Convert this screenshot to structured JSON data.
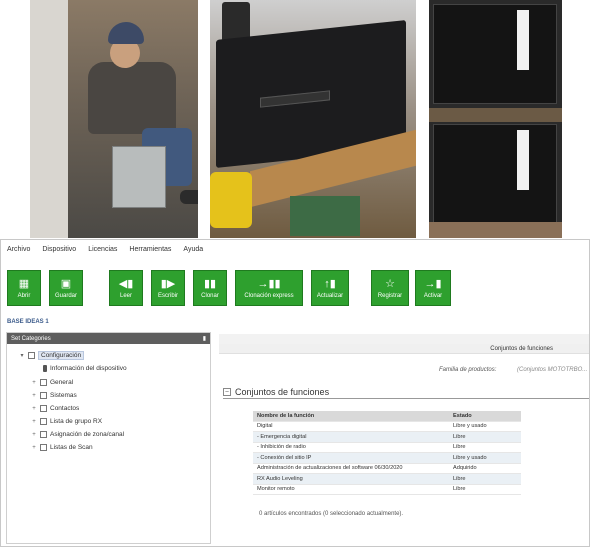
{
  "menu": [
    "Archivo",
    "Dispositivo",
    "Licencias",
    "Herramientas",
    "Ayuda"
  ],
  "toolbar": [
    {
      "label": "Abrir",
      "icon": "open-folder-icon"
    },
    {
      "label": "Guardar",
      "icon": "save-icon"
    },
    {
      "label": "Leer",
      "icon": "read-icon"
    },
    {
      "label": "Escribir",
      "icon": "write-icon"
    },
    {
      "label": "Clonar",
      "icon": "clone-icon"
    },
    {
      "label": "Clonación express",
      "icon": "express-clone-icon"
    },
    {
      "label": "Actualizar",
      "icon": "update-icon"
    },
    {
      "label": "Registrar",
      "icon": "register-star-icon"
    },
    {
      "label": "Activar",
      "icon": "activate-icon"
    }
  ],
  "base_label": "BASE IDEAS 1",
  "left_panel": {
    "header": "Set Categories",
    "tree": [
      "Configuración",
      "Información del dispositivo",
      "General",
      "Sistemas",
      "Contactos",
      "Lista de grupo RX",
      "Asignación de zona/canal",
      "Listas de Scan"
    ]
  },
  "right_panel": {
    "tab_label": "Conjuntos de funciones",
    "family_label": "Familia de productos:",
    "family_value": "(Conjuntos MOTOTRBO...",
    "section_title": "Conjuntos de funciones",
    "table": {
      "headers": [
        "Nombre de la función",
        "Estado"
      ],
      "rows": [
        [
          "Digital",
          "Libre y usado"
        ],
        [
          "- Emergencia digital",
          "Libre"
        ],
        [
          "- Inhibición de radio",
          "Libre"
        ],
        [
          "- Conexión del sitio IP",
          "Libre y usado"
        ],
        [
          "Administración de actualizaciones del software 06/30/2020",
          "Adquirido"
        ],
        [
          "RX Audio Leveling",
          "Libre"
        ],
        [
          "Monitor remoto",
          "Libre"
        ]
      ]
    },
    "status": "0 artículos encontrados (0 seleccionado actualmente)."
  }
}
